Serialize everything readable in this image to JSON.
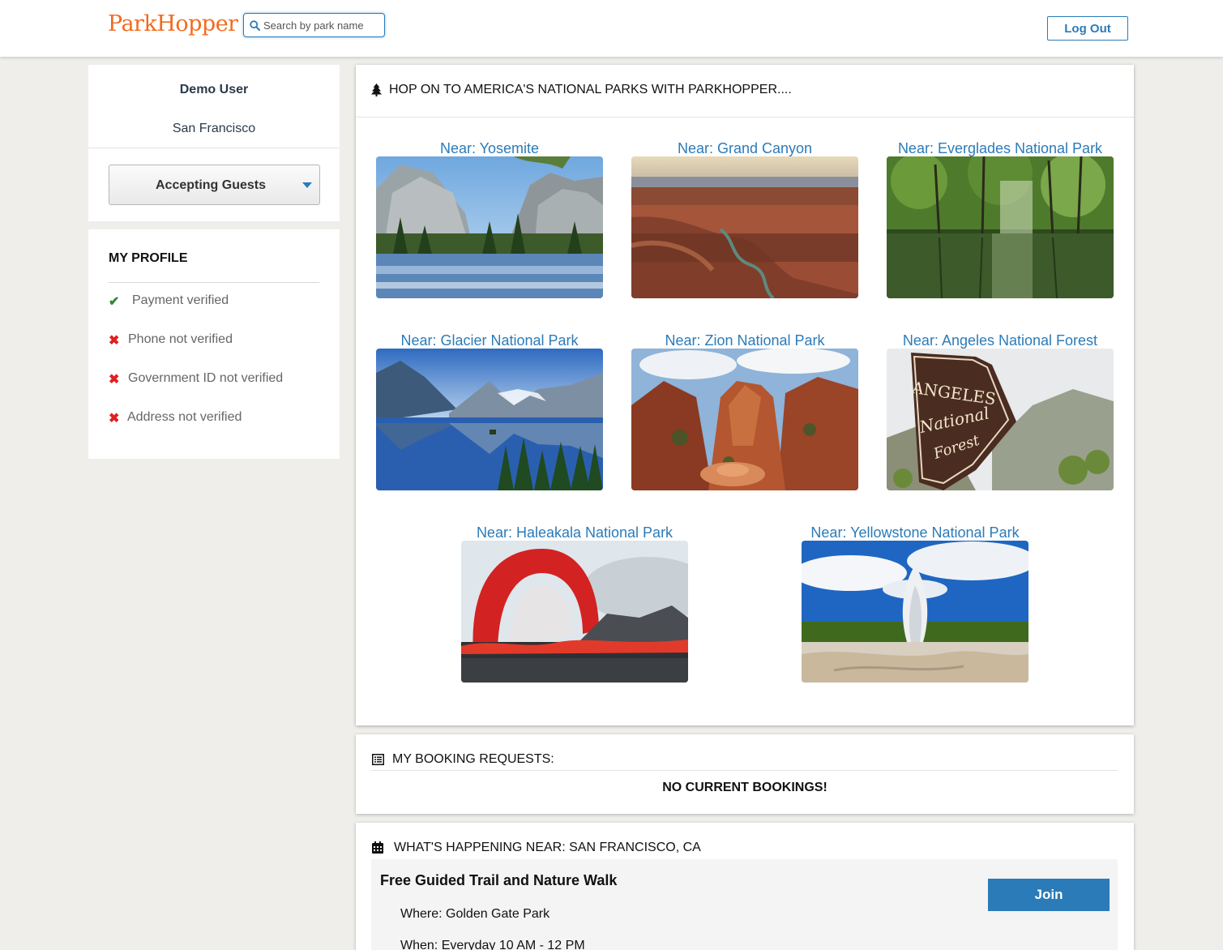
{
  "header": {
    "logo": "ParkHopper",
    "search_placeholder": "Search by park name",
    "logout_label": "Log Out"
  },
  "user": {
    "name": "Demo User",
    "city": "San Francisco",
    "status": "Accepting Guests"
  },
  "profile": {
    "title": "MY PROFILE",
    "items": [
      {
        "label": "Payment verified",
        "verified": true
      },
      {
        "label": "Phone not verified",
        "verified": false
      },
      {
        "label": "Government ID not verified",
        "verified": false
      },
      {
        "label": "Address not verified",
        "verified": false
      }
    ]
  },
  "parks": {
    "heading": "HOP ON TO AMERICA'S NATIONAL PARKS WITH PARKHOPPER....",
    "items": [
      {
        "label": "Near: Yosemite"
      },
      {
        "label": "Near: Grand Canyon"
      },
      {
        "label": "Near: Everglades National Park"
      },
      {
        "label": "Near: Glacier National Park"
      },
      {
        "label": "Near: Zion National Park"
      },
      {
        "label": "Near: Angeles National Forest"
      },
      {
        "label": "Near: Haleakala National Park"
      },
      {
        "label": "Near: Yellowstone National Park"
      }
    ]
  },
  "bookings": {
    "heading": "MY BOOKING REQUESTS:",
    "empty_text": "NO CURRENT BOOKINGS!"
  },
  "events": {
    "heading": "WHAT'S HAPPENING NEAR: SAN FRANCISCO, CA",
    "items": [
      {
        "title": "Free Guided Trail and Nature Walk",
        "where": "Where: Golden Gate Park",
        "when": "When: Everyday 10 AM - 12 PM",
        "join_label": "Join"
      }
    ]
  },
  "colors": {
    "brand": "#f26b1d",
    "accent": "#2b7bb9",
    "verified": "#2e8b2e",
    "unverified": "#e02020"
  }
}
